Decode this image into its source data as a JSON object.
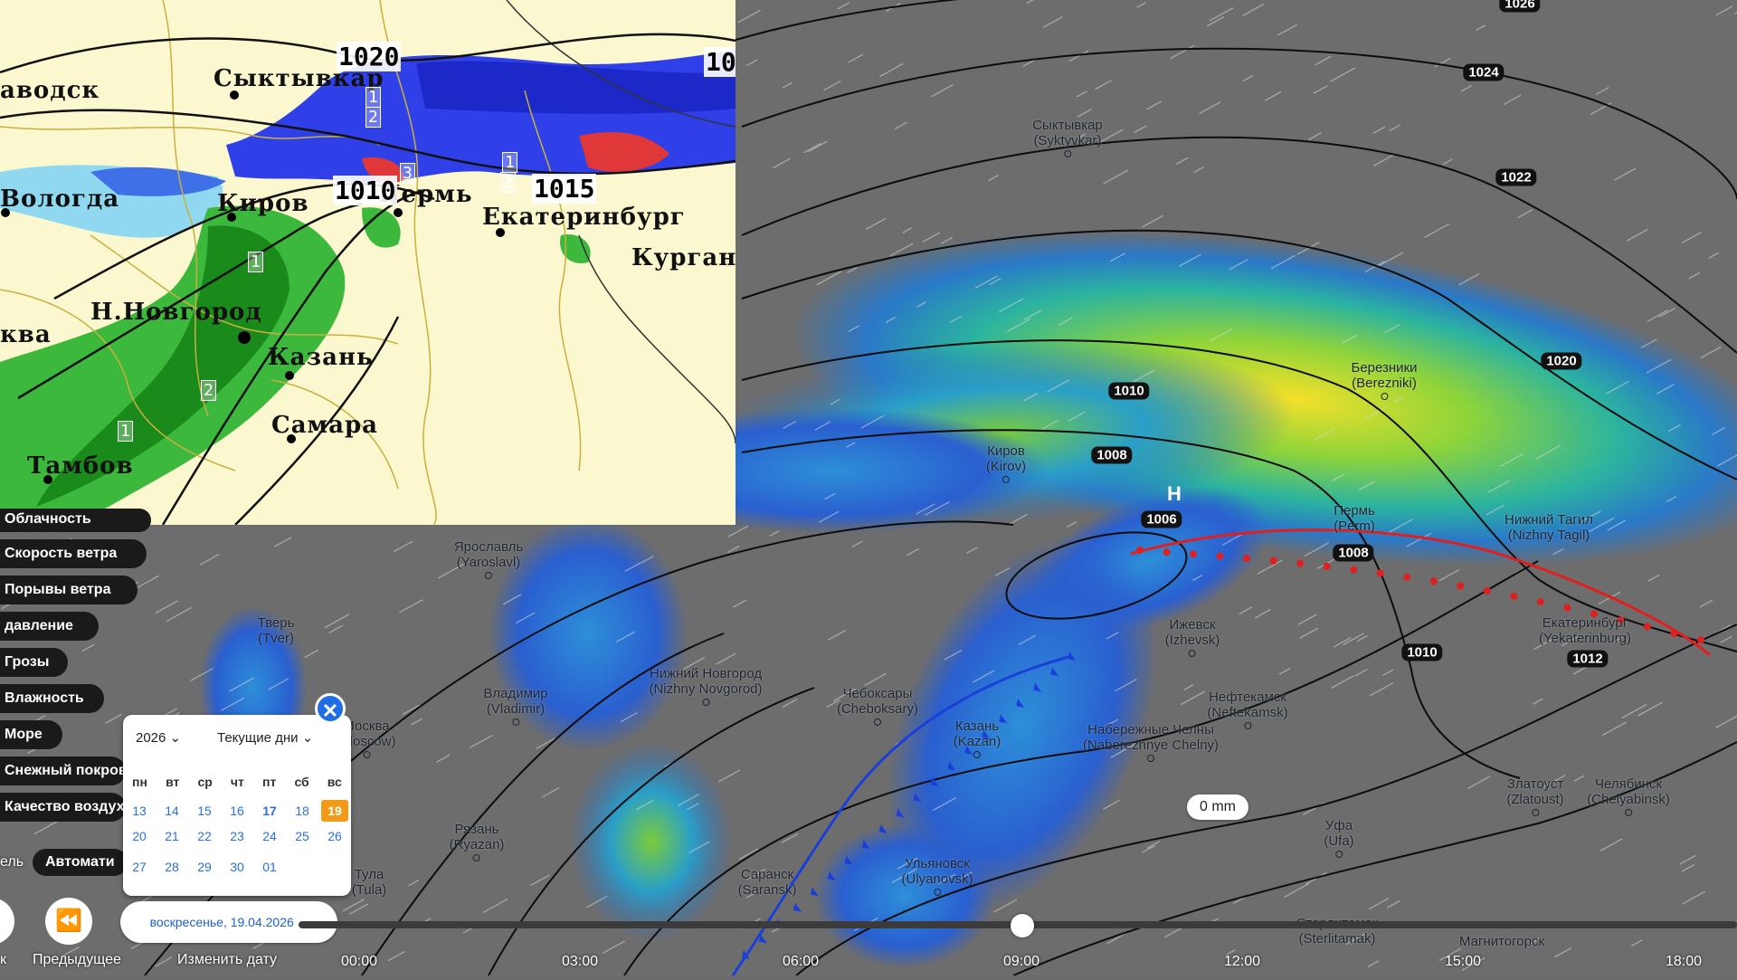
{
  "inset_map": {
    "cities": [
      "Сыктывкар",
      "аводск",
      "Вологда",
      "Киров",
      "Пермь",
      "Екатеринбург",
      "Курган",
      "Н.Новгород",
      "Казань",
      "Самара",
      "Тамбов",
      "ква"
    ],
    "pressure_labels": [
      "1020",
      "10",
      "1010",
      "1015"
    ],
    "zone_numbers": [
      "1",
      "2",
      "3",
      "1",
      "2",
      "1",
      "2",
      "1"
    ]
  },
  "main_map": {
    "cities": [
      {
        "ru": "Сыктывкар",
        "en": "(Syktyvkar)"
      },
      {
        "ru": "Березники",
        "en": "(Berezniki)"
      },
      {
        "ru": "Киров",
        "en": "(Kirov)"
      },
      {
        "ru": "Пермь",
        "en": "(Perm)"
      },
      {
        "ru": "Нижний Тагил",
        "en": "(Nizhny Tagil)"
      },
      {
        "ru": "Ярославль",
        "en": "(Yaroslavl)"
      },
      {
        "ru": "Тверь",
        "en": "(Tver)"
      },
      {
        "ru": "Ижевск",
        "en": "(Izhevsk)"
      },
      {
        "ru": "Екатеринбург",
        "en": "(Yekaterinburg)"
      },
      {
        "ru": "Нижний Новгород",
        "en": "(Nizhny Novgorod)"
      },
      {
        "ru": "Владимир",
        "en": "(Vladimir)"
      },
      {
        "ru": "Чебоксары",
        "en": "(Cheboksary)"
      },
      {
        "ru": "Нефтекамск",
        "en": "(Neftekamsk)"
      },
      {
        "ru": "Москва",
        "en": "(Moscow)"
      },
      {
        "ru": "Казань",
        "en": "(Kazan)"
      },
      {
        "ru": "Набережные Челны",
        "en": "(Naberezhnye Chelny)"
      },
      {
        "ru": "Златоуст",
        "en": "(Zlatoust)"
      },
      {
        "ru": "Челябинск",
        "en": "(Chelyabinsk)"
      },
      {
        "ru": "Рязань",
        "en": "(Ryazan)"
      },
      {
        "ru": "Уфа",
        "en": "(Ufa)"
      },
      {
        "ru": "Саранск",
        "en": "(Saransk)"
      },
      {
        "ru": "Ульяновск",
        "en": "(Ulyanovsk)"
      },
      {
        "ru": "Тула",
        "en": "(Tula)"
      },
      {
        "ru": "Стерлитамак",
        "en": "(Sterlitamak)"
      },
      {
        "ru": "Магнитогорск",
        "en": "(Magnitogorsk)"
      }
    ],
    "isobars": [
      "1026",
      "1024",
      "1022",
      "1020",
      "1010",
      "1008",
      "1006",
      "1008",
      "1010",
      "1012"
    ],
    "low_marker": "Н",
    "precip_label": "0 mm"
  },
  "layers": [
    "Облачность",
    "Скорость ветра",
    "Порывы ветра",
    "давление",
    "Грозы",
    "Влажность",
    "Море",
    "Снежный покров",
    "Качество воздуха"
  ],
  "calendar": {
    "year": "2026",
    "mode": "Текущие дни",
    "weekdays": [
      "пн",
      "вт",
      "ср",
      "чт",
      "пт",
      "сб",
      "вс"
    ],
    "weeks": [
      [
        "13",
        "14",
        "15",
        "16",
        "17",
        "18",
        "19"
      ],
      [
        "20",
        "21",
        "22",
        "23",
        "24",
        "25",
        "26"
      ],
      [
        "27",
        "28",
        "29",
        "30",
        "01",
        "",
        ""
      ]
    ],
    "selected_day": "19",
    "close_label": "✕"
  },
  "controls": {
    "auto_label": "Автомати",
    "prev_label": "Предыдущее",
    "change_date_label": "Изменить дату",
    "date_value": "воскресенье, 19.04.2026",
    "left_cut_label": "к",
    "level_cut_label": "ель"
  },
  "timeline": {
    "times": [
      "00:00",
      "03:00",
      "06:00",
      "09:00",
      "12:00",
      "15:00",
      "18:00"
    ],
    "progress": 0.37
  },
  "colors": {
    "map_background": "#6b6b6b",
    "accent": "#1e6de3",
    "today": "#f39a18",
    "warm_front": "#e02020",
    "cold_front": "#1a3fd8"
  }
}
